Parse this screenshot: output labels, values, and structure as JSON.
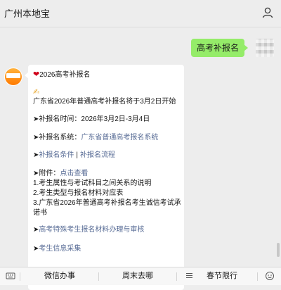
{
  "header": {
    "title": "广州本地宝",
    "user_icon": "user-icon"
  },
  "user_message": {
    "text": "高考补报名"
  },
  "bot_message": {
    "heading": "2026高考补报名",
    "announce_link": "广东省2026年普通高考补报名将于3月2日开始",
    "time_label": "➤补报名时间：",
    "time_value": "2026年3月2日-3月4日",
    "system_label": "➤补报名系统：",
    "system_link": "广东省普通高考报名系统",
    "arrow": "➤",
    "cond_link": "补报名条件",
    "separator": "|",
    "process_link": "补报名流程",
    "attach_label": "➤附件：",
    "attach_link": "点击查看",
    "attach_items": [
      "1.考生属性与考试科目之间关系的说明",
      "2.考生类型与报名材料对应表",
      "3.广东省2026年普通高考补报名考生诚信考试承",
      "诺书"
    ],
    "special_link": "高考特殊考生报名材料办理与审核",
    "collect_link": "考生信息采集"
  },
  "bottom_menu": {
    "items": [
      "微信办事",
      "周末去哪",
      "春节限行"
    ]
  },
  "colors": {
    "bg": "#ededed",
    "user_bubble": "#95ec69",
    "link": "#576b95"
  }
}
